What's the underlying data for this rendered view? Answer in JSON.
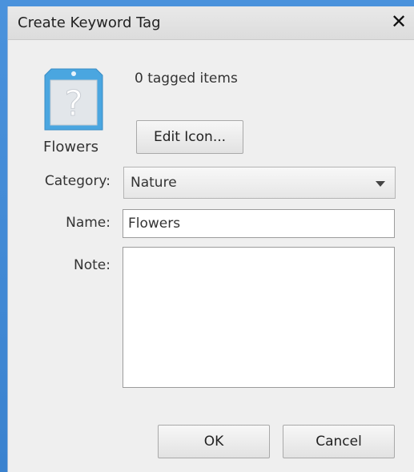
{
  "window": {
    "title": "Create Keyword Tag",
    "close_glyph": "✕",
    "close_icon": "close-icon"
  },
  "tag": {
    "icon": "question-mark-tag-icon",
    "icon_label": "Flowers",
    "tagged_count_text": "0 tagged items",
    "edit_icon_button": "Edit Icon..."
  },
  "form": {
    "category_label": "Category:",
    "category_value": "Nature",
    "name_label": "Name:",
    "name_value": "Flowers",
    "note_label": "Note:",
    "note_value": ""
  },
  "buttons": {
    "ok": "OK",
    "cancel": "Cancel"
  },
  "colors": {
    "desktop_blue": "#3f87d3",
    "icon_blue": "#4aa6e0",
    "dialog_bg": "#efefef"
  }
}
